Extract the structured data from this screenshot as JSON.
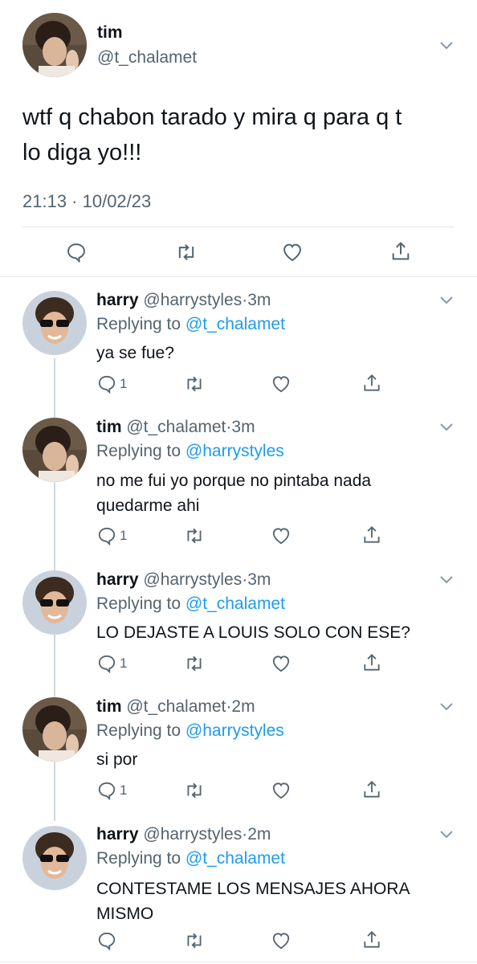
{
  "main_tweet": {
    "name": "tim",
    "handle": "@t_chalamet",
    "text_line1": "wtf q chabon tarado y mira q para q t",
    "text_line2": "lo diga yo!!!",
    "timestamp": "21:13 · 10/02/23"
  },
  "replies": [
    {
      "name": "harry",
      "handle": "@harrystyles",
      "time": "3m",
      "replying_label": "Replying to",
      "replying_to": "@t_chalamet",
      "lines": [
        "ya se fue?"
      ],
      "reply_count": "1"
    },
    {
      "name": "tim",
      "handle": "@t_chalamet",
      "time": "3m",
      "replying_label": "Replying to",
      "replying_to": "@harrystyles",
      "lines": [
        "no me fui yo porque no pintaba nada",
        "quedarme ahi"
      ],
      "reply_count": "1"
    },
    {
      "name": "harry",
      "handle": "@harrystyles",
      "time": "3m",
      "replying_label": "Replying to",
      "replying_to": "@t_chalamet",
      "lines": [
        "LO DEJASTE A LOUIS SOLO CON ESE?"
      ],
      "reply_count": "1"
    },
    {
      "name": "tim",
      "handle": "@t_chalamet",
      "time": "2m",
      "replying_label": "Replying to",
      "replying_to": "@harrystyles",
      "lines": [
        "si por"
      ],
      "reply_count": "1"
    },
    {
      "name": "harry",
      "handle": "@harrystyles",
      "time": "2m",
      "replying_label": "Replying to",
      "replying_to": "@t_chalamet",
      "lines": [
        "CONTESTAME LOS MENSAJES AHORA",
        "MISMO"
      ],
      "reply_count": ""
    }
  ],
  "separator": "·",
  "icons": {
    "reply": "reply-icon",
    "retweet": "retweet-icon",
    "like": "heart-icon",
    "share": "share-icon",
    "more": "chevron-down-icon"
  },
  "colors": {
    "link": "#1d9bf0",
    "muted": "#536471",
    "divider": "#e1e8ed"
  }
}
